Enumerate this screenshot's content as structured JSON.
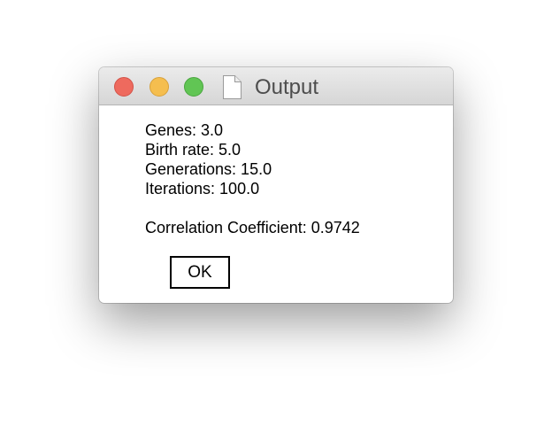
{
  "window": {
    "title": "Output",
    "title_icon": "document-icon"
  },
  "content": {
    "genes": "Genes: 3.0",
    "birth_rate": "Birth rate: 5.0",
    "generations": "Generations: 15.0",
    "iterations": "Iterations: 100.0",
    "correlation": "Correlation Coefficient: 0.9742"
  },
  "buttons": {
    "ok_label": "OK"
  },
  "colors": {
    "close": "#ee6a5e",
    "minimize": "#f5be4f",
    "zoom": "#61c554"
  }
}
